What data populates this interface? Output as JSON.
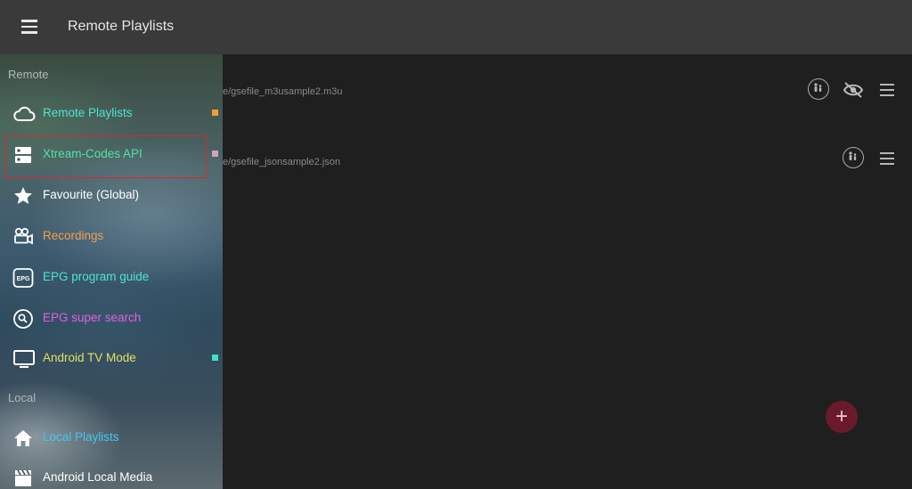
{
  "appbar": {
    "title": "Remote Playlists",
    "menu_icon": "hamburger-menu-icon"
  },
  "drawer": {
    "sections": {
      "remote": "Remote",
      "local": "Local"
    },
    "items": [
      {
        "label": "Remote Playlists",
        "icon": "cloud-icon",
        "color": "#4fe3d1",
        "dot": "#f0a030"
      },
      {
        "label": "Xtream-Codes API",
        "icon": "server-icon",
        "color": "#4fe3a3",
        "dot": "#d9a0b0",
        "selected": true
      },
      {
        "label": "Favourite (Global)",
        "icon": "star-icon",
        "color": "#ffffff"
      },
      {
        "label": "Recordings",
        "icon": "movie-camera-icon",
        "color": "#f0a050"
      },
      {
        "label": "EPG program guide",
        "icon": "epg-icon",
        "color": "#4fe3d1"
      },
      {
        "label": "EPG super search",
        "icon": "search-icon",
        "color": "#e060e0"
      },
      {
        "label": "Android TV Mode",
        "icon": "tv-icon",
        "color": "#e0e060",
        "dot": "#40e0c0"
      },
      {
        "label": "Local Playlists",
        "icon": "home-icon",
        "color": "#40c8f0"
      },
      {
        "label": "Android Local Media",
        "icon": "clapperboard-icon",
        "color": "#ffffff"
      }
    ]
  },
  "playlists": [
    {
      "path": "e/gsefile_m3usample2.m3u",
      "icons": [
        "parental-lock-icon",
        "hidden-eye-icon",
        "more-menu-icon"
      ]
    },
    {
      "path": "e/gsefile_jsonsample2.json",
      "icons": [
        "parental-lock-icon",
        "more-menu-icon"
      ]
    }
  ],
  "fab": {
    "label": "+",
    "icon": "add-icon"
  }
}
